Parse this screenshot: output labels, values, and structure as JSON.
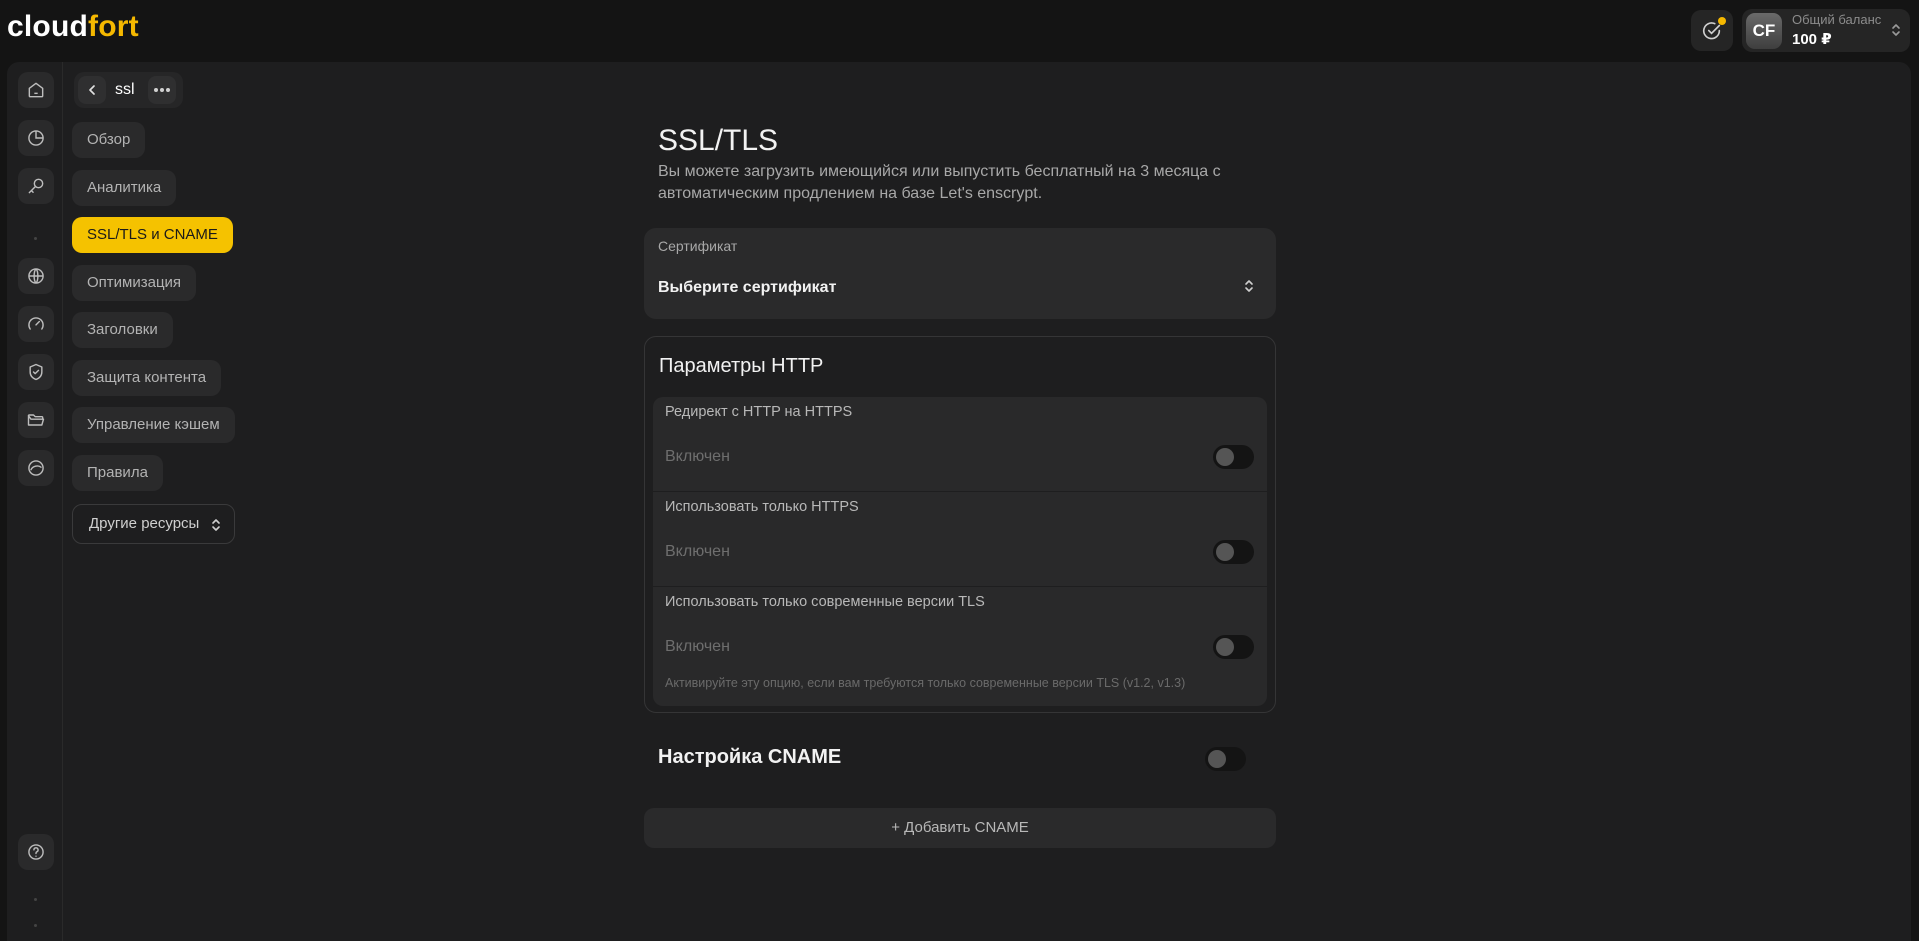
{
  "brand": {
    "logo_part1": "cloud",
    "logo_part2": "fort",
    "accent_color": "#f5b800"
  },
  "header": {
    "notifications_icon": "check-circle-icon",
    "avatar_initials": "CF",
    "balance_label": "Общий баланс",
    "balance_value": "100 ₽"
  },
  "rail": {
    "items": [
      "home-icon",
      "analytics-icon",
      "key-icon",
      "globe-icon",
      "speedometer-icon",
      "shield-icon",
      "folder-icon",
      "gauge-icon",
      "help-icon"
    ]
  },
  "breadcrumb": {
    "title": "ssl"
  },
  "sidebar": {
    "items": [
      {
        "label": "Обзор"
      },
      {
        "label": "Аналитика"
      },
      {
        "label": "SSL/TLS и CNAME",
        "active": true
      },
      {
        "label": "Оптимизация"
      },
      {
        "label": "Заголовки"
      },
      {
        "label": "Защита контента"
      },
      {
        "label": "Управление кэшем"
      },
      {
        "label": "Правила"
      }
    ],
    "other_resources": "Другие ресурсы"
  },
  "page": {
    "title": "SSL/TLS",
    "description": "Вы можете загрузить имеющийся или выпустить бесплатный на 3 месяца с автоматическим продлением на базе Let's enscrypt.",
    "certificate": {
      "label": "Сертификат",
      "value": "Выберите сертификат"
    },
    "http": {
      "title": "Параметры HTTP",
      "options": [
        {
          "label": "Редирект с HTTP на HTTPS",
          "state": "Включен",
          "enabled": false
        },
        {
          "label": "Использовать только HTTPS",
          "state": "Включен",
          "enabled": false
        },
        {
          "label": "Использовать только современные версии TLS",
          "state": "Включен",
          "enabled": false,
          "hint": "Активируйте эту опцию, если вам требуются только современные версии TLS (v1.2, v1.3)"
        }
      ]
    },
    "cname": {
      "title": "Настройка CNAME",
      "enabled": false,
      "add_label": "+ Добавить CNAME"
    }
  }
}
